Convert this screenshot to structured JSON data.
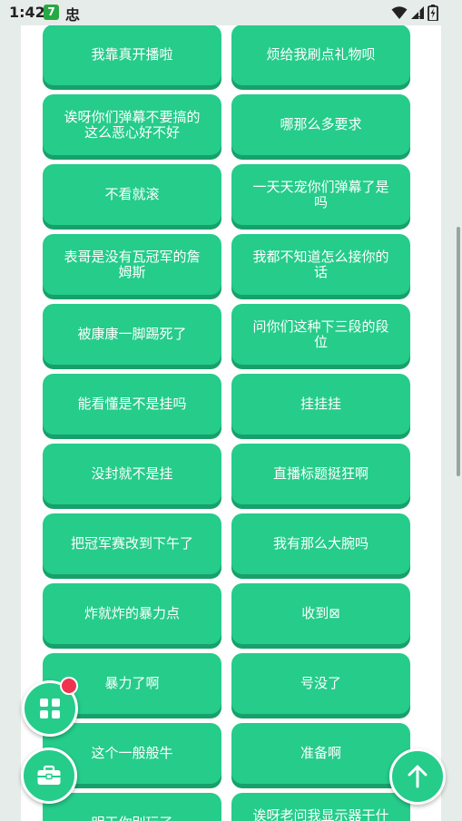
{
  "status_bar": {
    "time": "1:42",
    "badge": "7",
    "app_glyph": "忠",
    "icons": [
      "wifi-icon",
      "signal-icon",
      "battery-icon"
    ]
  },
  "colors": {
    "button_green": "#25cc8a",
    "button_shadow": "#17a06b",
    "badge_red": "#f0334f",
    "background": "#e6ece9"
  },
  "phrases": [
    "我靠真开播啦",
    "烦给我刷点礼物呗",
    "诶呀你们弹幕不要搞的这么恶心好不好",
    "哪那么多要求",
    "不看就滚",
    "一天天宠你们弹幕了是吗",
    "表哥是没有瓦冠军的詹姆斯",
    "我都不知道怎么接你的话",
    "被康康一脚踢死了",
    "问你们这种下三段的段位",
    "能看懂是不是挂吗",
    "挂挂挂",
    "没封就不是挂",
    "直播标题挺狂啊",
    "把冠军赛改到下午了",
    "我有那么大腕吗",
    "炸就炸的暴力点",
    "收到⊠",
    "暴力了啊",
    "号没了",
    "这个一般般牛",
    "准备啊",
    "明天你别玩了",
    "诶呀老问我显示器干什么"
  ],
  "fabs": {
    "grid_menu": "grid-icon",
    "toolbox": "toolbox-icon",
    "scroll_top": "arrow-up-icon"
  }
}
